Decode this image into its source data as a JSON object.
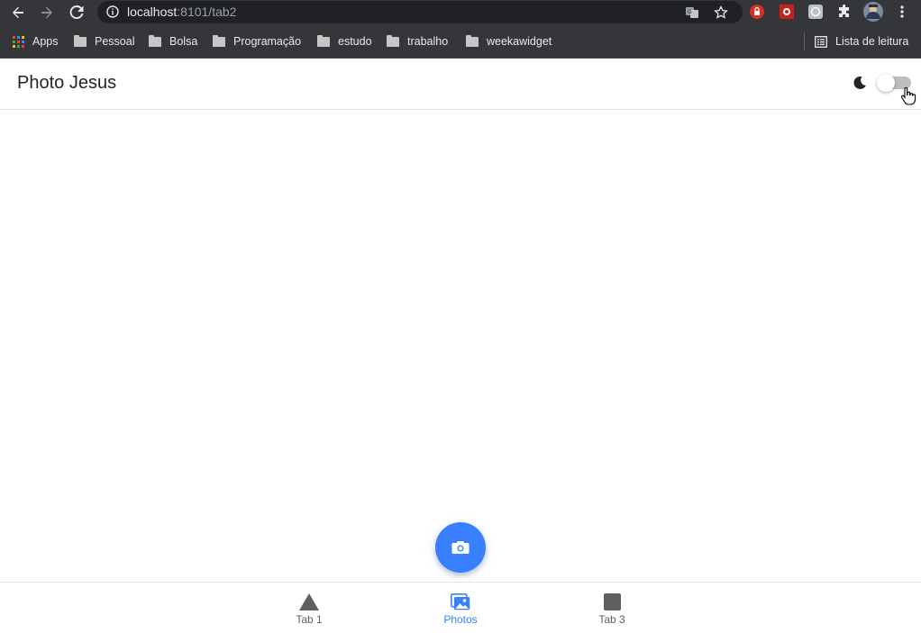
{
  "browser": {
    "url_host": "localhost",
    "url_path": ":8101/tab2",
    "bookmarks": [
      {
        "label": "Apps"
      },
      {
        "label": "Pessoal"
      },
      {
        "label": "Bolsa"
      },
      {
        "label": "Programação"
      },
      {
        "label": "estudo"
      },
      {
        "label": "trabalho"
      },
      {
        "label": "weekawidget"
      }
    ],
    "reading_list": "Lista de leitura"
  },
  "header": {
    "title": "Photo Jesus",
    "dark_mode_enabled": false
  },
  "fab": {
    "icon": "camera-icon",
    "color": "#3880ff"
  },
  "tabs": [
    {
      "label": "Tab 1",
      "icon": "triangle-icon"
    },
    {
      "label": "Photos",
      "icon": "images-icon",
      "selected": true
    },
    {
      "label": "Tab 3",
      "icon": "square-icon"
    }
  ],
  "colors": {
    "primary": "#3880ff",
    "chrome": "#35363a",
    "omnibox": "#202124"
  }
}
